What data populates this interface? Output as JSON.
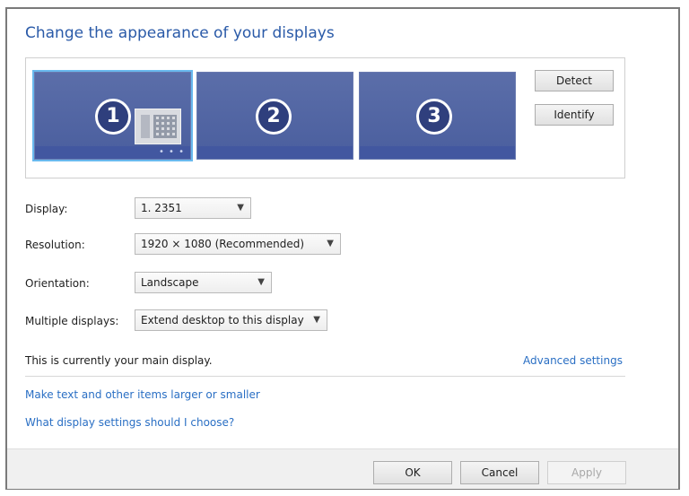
{
  "heading": "Change the appearance of your displays",
  "monitors": [
    {
      "number": "1",
      "selected": true
    },
    {
      "number": "2",
      "selected": false
    },
    {
      "number": "3",
      "selected": false
    }
  ],
  "buttons": {
    "detect": "Detect",
    "identify": "Identify",
    "ok": "OK",
    "cancel": "Cancel",
    "apply": "Apply"
  },
  "fields": {
    "display": {
      "label": "Display:",
      "value": "1. 2351"
    },
    "resolution": {
      "label": "Resolution:",
      "value": "1920 × 1080 (Recommended)"
    },
    "orientation": {
      "label": "Orientation:",
      "value": "Landscape"
    },
    "multiple_displays": {
      "label": "Multiple displays:",
      "value": "Extend desktop to this display"
    }
  },
  "info_text": "This is currently your main display.",
  "links": {
    "advanced": "Advanced settings",
    "larger_text": "Make text and other items larger or smaller",
    "which_settings": "What display settings should I choose?"
  },
  "colors": {
    "accent": "#2a5aa8",
    "link": "#2a6fc4",
    "monitor": "#4a5e9e"
  }
}
